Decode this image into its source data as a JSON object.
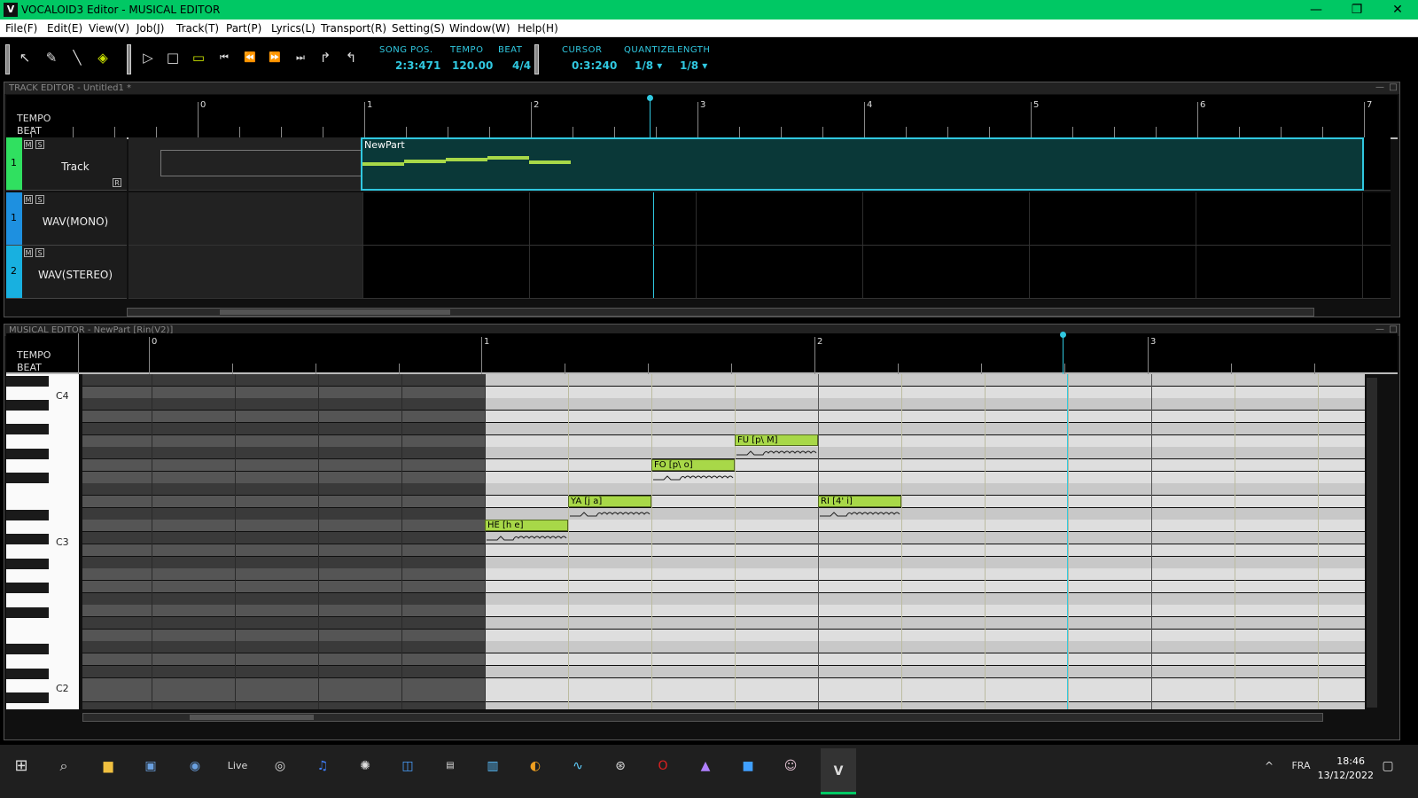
{
  "window": {
    "title": "VOCALOID3 Editor - MUSICAL EDITOR",
    "icon": "V",
    "minimize": "—",
    "maximize": "❐",
    "close": "✕"
  },
  "menu": [
    "File(F)",
    "Edit(E)",
    "View(V)",
    "Job(J)",
    "Track(T)",
    "Part(P)",
    "Lyrics(L)",
    "Transport(R)",
    "Setting(S)",
    "Window(W)",
    "Help(H)"
  ],
  "toolbar": {
    "song_pos_label": "SONG POS.",
    "song_pos": "2:3:471",
    "tempo_label": "TEMPO",
    "tempo": "120.00",
    "beat_label": "BEAT",
    "beat": "4/4",
    "cursor_label": "CURSOR",
    "cursor": "0:3:240",
    "quantize_label": "QUANTIZE",
    "quantize": "1/8",
    "length_label": "LENGTH",
    "length": "1/8"
  },
  "track_editor": {
    "title": "TRACK EDITOR - Untitled1 *",
    "tempo_label": "TEMPO",
    "beat_label": "BEAT",
    "bars": [
      "0",
      "1",
      "2",
      "3",
      "4",
      "5",
      "6",
      "7"
    ],
    "tracks": [
      {
        "num": "1",
        "name": "Track",
        "m": "M",
        "s": "S",
        "r": "R"
      },
      {
        "num": "1",
        "name": "WAV(MONO)",
        "m": "M",
        "s": "S"
      },
      {
        "num": "2",
        "name": "WAV(STEREO)",
        "m": "M",
        "s": "S"
      }
    ],
    "part_name": "NewPart"
  },
  "musical_editor": {
    "title": "MUSICAL EDITOR - NewPart [Rin(V2)]",
    "tempo_label": "TEMPO",
    "beat_label": "BEAT",
    "bars": [
      "0",
      "1",
      "2",
      "3"
    ],
    "keys": [
      "C4",
      "C3",
      "C2"
    ],
    "notes": [
      {
        "label": "HE [h e]"
      },
      {
        "label": "YA [j a]"
      },
      {
        "label": "FO [p\\ o]"
      },
      {
        "label": "FU [p\\ M]"
      },
      {
        "label": "RI [4' i]"
      }
    ]
  },
  "taskbar": {
    "live_label": "Live",
    "lang": "FRA",
    "time": "18:46",
    "date": "13/12/2022"
  },
  "colors": {
    "accent": "#30c8e0",
    "note": "#a8d848",
    "titlebar": "#00c864",
    "track1": "#30e060",
    "wav": "#1e90e0"
  }
}
